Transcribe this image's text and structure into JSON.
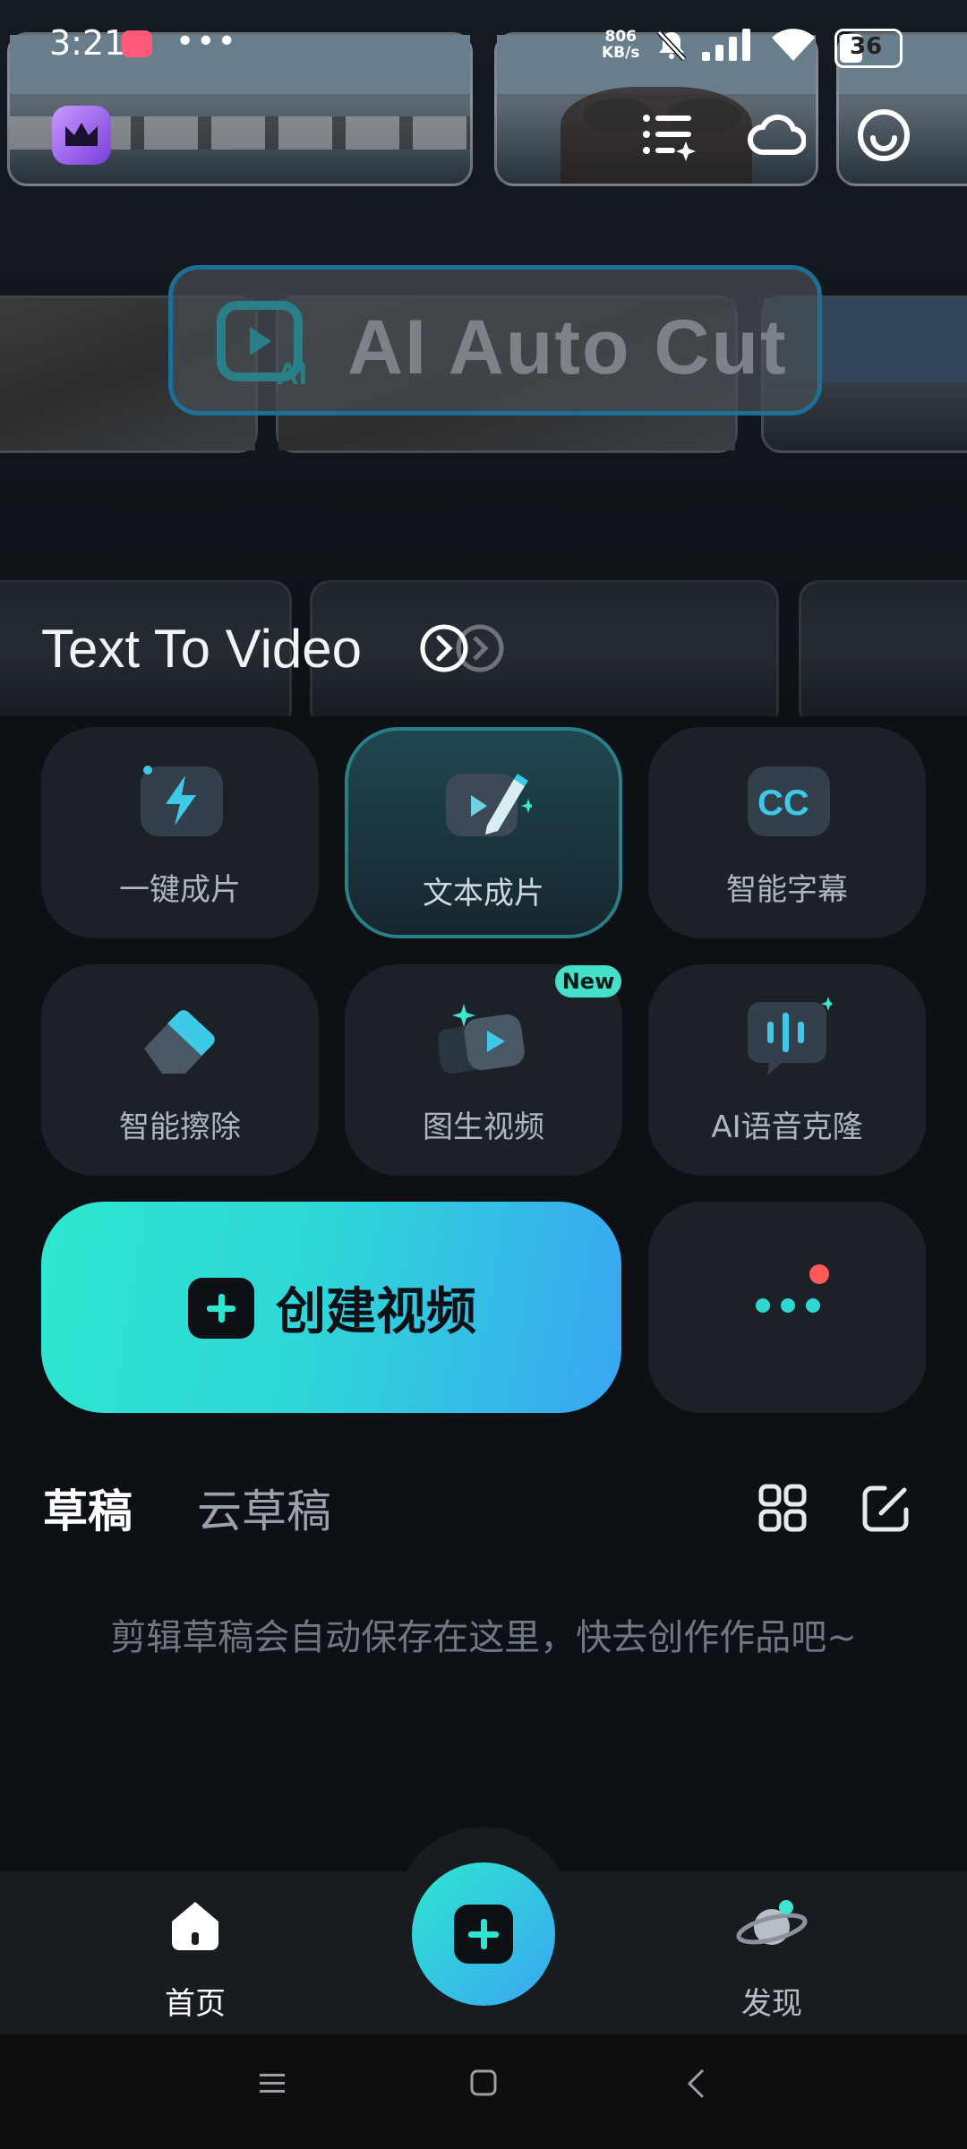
{
  "status_bar": {
    "time": "3:21",
    "net_speed_value": "806",
    "net_speed_unit": "KB/s",
    "battery": "36"
  },
  "banner": {
    "title": "AI Auto Cut"
  },
  "feature_link": {
    "label": "Text To Video"
  },
  "tools": [
    {
      "label": "一键成片",
      "icon": "lightning-icon",
      "active": false
    },
    {
      "label": "文本成片",
      "icon": "text-to-video-pen-icon",
      "active": true
    },
    {
      "label": "智能字幕",
      "icon": "cc-subtitle-icon",
      "active": false
    },
    {
      "label": "智能擦除",
      "icon": "eraser-icon",
      "active": false
    },
    {
      "label": "图生视频",
      "icon": "image-to-video-icon",
      "active": false,
      "badge": "New"
    },
    {
      "label": "AI语音克隆",
      "icon": "voice-clone-icon",
      "active": false
    }
  ],
  "create_button": {
    "label": "创建视频"
  },
  "drafts": {
    "tab_local": "草稿",
    "tab_cloud": "云草稿",
    "empty_message": "剪辑草稿会自动保存在这里，快去创作作品吧~"
  },
  "bottom_nav": {
    "home": "首页",
    "discover": "发现"
  },
  "colors": {
    "accent_teal": "#2ee6cf",
    "accent_blue": "#3aa6f2",
    "background": "#0d1116",
    "card": "#1c2128",
    "badge_red": "#ff5a5a"
  }
}
